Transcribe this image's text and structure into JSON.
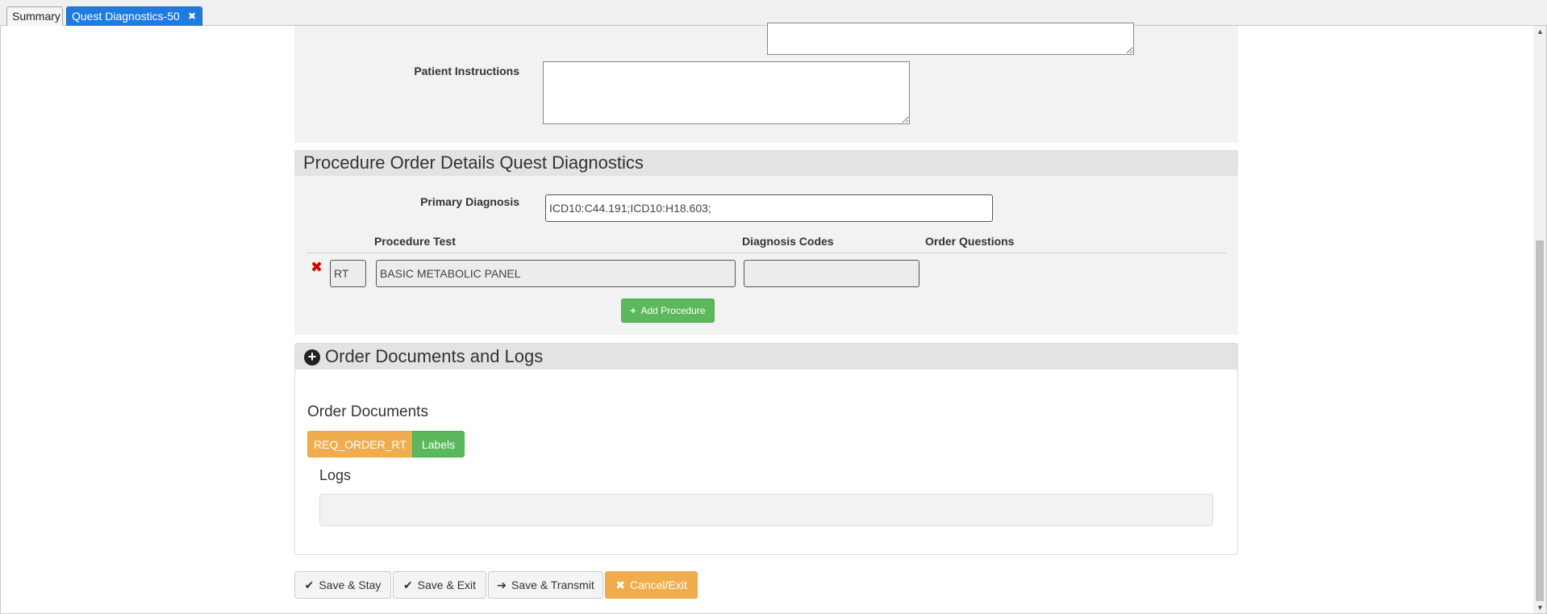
{
  "tabs": [
    {
      "label": "Summary"
    },
    {
      "label": "Quest Diagnostics-50"
    }
  ],
  "form": {
    "patient_instructions_label": "Patient Instructions",
    "patient_instructions_value": "",
    "previous_textarea_value": ""
  },
  "procedure_section": {
    "title": "Procedure Order Details Quest Diagnostics",
    "primary_diagnosis_label": "Primary Diagnosis",
    "primary_diagnosis_value": "ICD10:C44.191;ICD10:H18.603;",
    "columns": {
      "procedure_test": "Procedure Test",
      "diagnosis_codes": "Diagnosis Codes",
      "order_questions": "Order Questions"
    },
    "rows": [
      {
        "code": "RT",
        "test": "BASIC METABOLIC PANEL",
        "diagnosis_codes": ""
      }
    ],
    "add_procedure_label": "Add Procedure"
  },
  "documents_section": {
    "title": "Order Documents and Logs",
    "order_documents_label": "Order Documents",
    "doc_buttons": [
      "REQ_ORDER_RT",
      "Labels"
    ],
    "logs_label": "Logs"
  },
  "footer": {
    "save_stay": "Save & Stay",
    "save_exit": "Save & Exit",
    "save_transmit": "Save & Transmit",
    "cancel_exit": "Cancel/Exit"
  },
  "icons": {
    "close": "close-icon",
    "delete": "delete-icon",
    "plus": "plus-circle-icon",
    "check": "check-icon",
    "arrow": "arrow-right-icon",
    "x": "times-icon"
  },
  "colors": {
    "active_tab": "#1e7be0",
    "success": "#5cb85c",
    "warning": "#f0ad4e",
    "danger": "#d40000"
  }
}
